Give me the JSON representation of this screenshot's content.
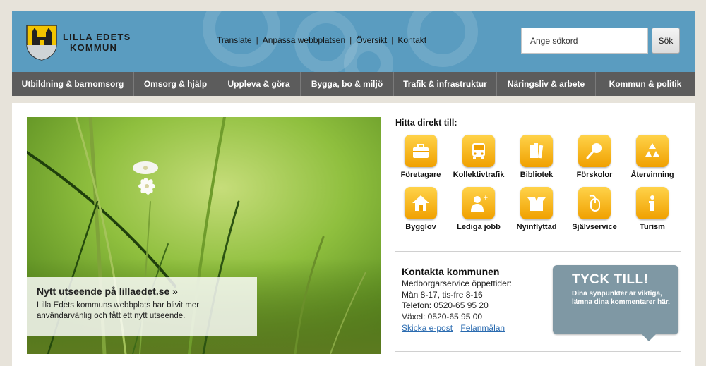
{
  "header": {
    "logo_line1": "LILLA EDETS",
    "logo_line2": "KOMMUN",
    "links": [
      "Translate",
      "Anpassa webbplatsen",
      "Översikt",
      "Kontakt"
    ],
    "search_placeholder": "Ange sökord",
    "search_button": "Sök"
  },
  "nav": {
    "items": [
      "Utbildning & barnomsorg",
      "Omsorg & hjälp",
      "Uppleva & göra",
      "Bygga, bo & miljö",
      "Trafik & infrastruktur",
      "Näringsliv & arbete",
      "Kommun & politik"
    ]
  },
  "hero": {
    "title": "Nytt utseende på lillaedet.se »",
    "text": "Lilla Edets kommuns webbplats har blivit mer användarvänlig och fått ett nytt utseende."
  },
  "quick": {
    "title": "Hitta direkt till:",
    "items": [
      {
        "label": "Företagare",
        "icon": "briefcase-icon"
      },
      {
        "label": "Kollektivtrafik",
        "icon": "bus-icon"
      },
      {
        "label": "Bibliotek",
        "icon": "books-icon"
      },
      {
        "label": "Förskolor",
        "icon": "rattle-icon"
      },
      {
        "label": "Återvinning",
        "icon": "recycle-icon"
      },
      {
        "label": "Bygglov",
        "icon": "house-icon"
      },
      {
        "label": "Lediga jobb",
        "icon": "person-plus-icon"
      },
      {
        "label": "Nyinflyttad",
        "icon": "box-icon"
      },
      {
        "label": "Självservice",
        "icon": "mouse-icon"
      },
      {
        "label": "Turism",
        "icon": "info-icon"
      }
    ]
  },
  "contact": {
    "title": "Kontakta kommunen",
    "lines": [
      "Medborgarservice öppettider:",
      "Mån 8-17, tis-fre 8-16",
      "Telefon: 0520-65 95 20",
      "Växel: 0520-65 95 00"
    ],
    "email_link": "Skicka e-post",
    "report_link": "Felanmälan"
  },
  "feedback": {
    "title": "TYCK TILL!",
    "text": "Dina synpunkter är viktiga, lämna dina kommentarer här."
  },
  "colors": {
    "header_bg": "#5a9cc0",
    "nav_bg": "#5c5c5c",
    "page_bg": "#e7e3da",
    "icon_yellow": "#f4b400",
    "feedback_bg": "#7f98a4",
    "link": "#2a6bb0"
  }
}
